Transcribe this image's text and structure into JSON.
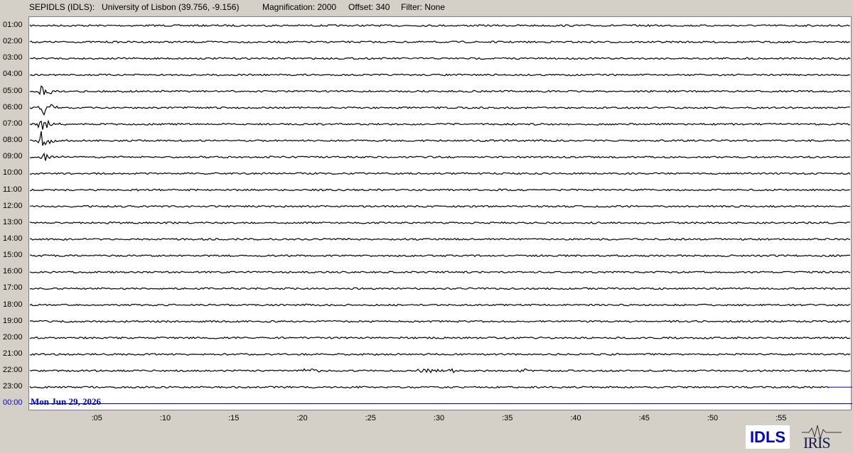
{
  "header": {
    "station": "SEPIDLS (IDLS):",
    "location": "University of Lisbon (39.756, -9.156)",
    "magnification": "Magnification: 2000",
    "offset": "Offset: 340",
    "filter": "Filter: None"
  },
  "hour_labels": [
    "01:00",
    "02:00",
    "03:00",
    "04:00",
    "05:00",
    "06:00",
    "07:00",
    "08:00",
    "09:00",
    "10:00",
    "11:00",
    "12:00",
    "13:00",
    "14:00",
    "15:00",
    "16:00",
    "17:00",
    "18:00",
    "19:00",
    "20:00",
    "21:00",
    "22:00",
    "23:00",
    "00:00"
  ],
  "minute_labels": [
    ":05",
    ":10",
    ":15",
    ":20",
    ":25",
    ":30",
    ":35",
    ":40",
    ":45",
    ":50",
    ":55"
  ],
  "date_label": "Mon Jun 29, 2026",
  "logos": {
    "idls": "IDLS",
    "iris": "IRIS"
  },
  "colors": {
    "trace": "#000000",
    "current_line": "#0000cc",
    "background": "#d4d0c8"
  },
  "event": {
    "hour_label": "07:00",
    "minute": 0.8
  }
}
